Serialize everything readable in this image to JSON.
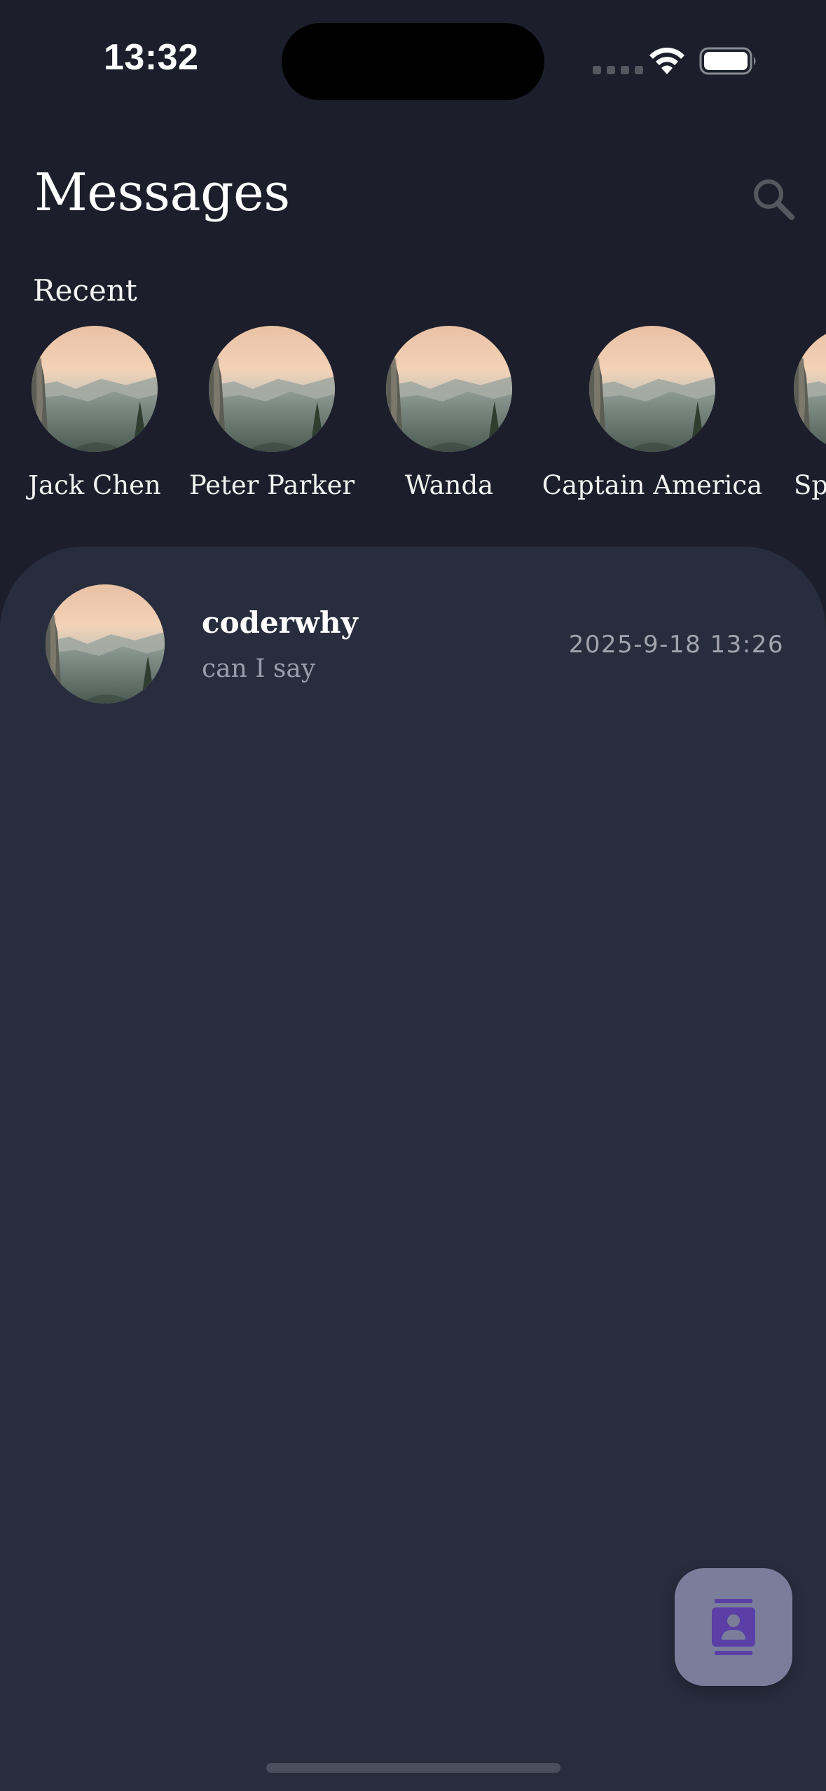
{
  "status_bar": {
    "time": "13:32"
  },
  "header": {
    "title": "Messages",
    "search_icon": "search-icon"
  },
  "recent": {
    "label": "Recent",
    "contacts": [
      {
        "name": "Jack Chen"
      },
      {
        "name": "Peter Parker"
      },
      {
        "name": "Wanda"
      },
      {
        "name": "Captain America"
      },
      {
        "name": "Sp"
      }
    ]
  },
  "messages": [
    {
      "name": "coderwhy",
      "preview": "can I say",
      "timestamp": "2025-9-18 13:26"
    }
  ],
  "fab": {
    "icon": "contacts-icon"
  },
  "colors": {
    "background": "#1c1f2b",
    "panel": "#282d3e",
    "fab": "#7a7e9b",
    "fab_icon": "#5b3fa6"
  }
}
